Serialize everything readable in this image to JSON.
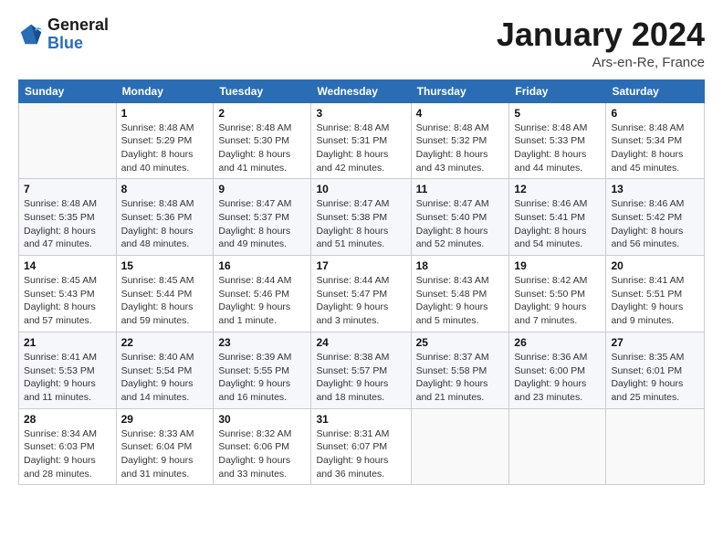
{
  "header": {
    "logo_line1": "General",
    "logo_line2": "Blue",
    "month_title": "January 2024",
    "location": "Ars-en-Re, France"
  },
  "weekdays": [
    "Sunday",
    "Monday",
    "Tuesday",
    "Wednesday",
    "Thursday",
    "Friday",
    "Saturday"
  ],
  "weeks": [
    [
      {
        "day": "",
        "info": ""
      },
      {
        "day": "1",
        "info": "Sunrise: 8:48 AM\nSunset: 5:29 PM\nDaylight: 8 hours\nand 40 minutes."
      },
      {
        "day": "2",
        "info": "Sunrise: 8:48 AM\nSunset: 5:30 PM\nDaylight: 8 hours\nand 41 minutes."
      },
      {
        "day": "3",
        "info": "Sunrise: 8:48 AM\nSunset: 5:31 PM\nDaylight: 8 hours\nand 42 minutes."
      },
      {
        "day": "4",
        "info": "Sunrise: 8:48 AM\nSunset: 5:32 PM\nDaylight: 8 hours\nand 43 minutes."
      },
      {
        "day": "5",
        "info": "Sunrise: 8:48 AM\nSunset: 5:33 PM\nDaylight: 8 hours\nand 44 minutes."
      },
      {
        "day": "6",
        "info": "Sunrise: 8:48 AM\nSunset: 5:34 PM\nDaylight: 8 hours\nand 45 minutes."
      }
    ],
    [
      {
        "day": "7",
        "info": "Sunrise: 8:48 AM\nSunset: 5:35 PM\nDaylight: 8 hours\nand 47 minutes."
      },
      {
        "day": "8",
        "info": "Sunrise: 8:48 AM\nSunset: 5:36 PM\nDaylight: 8 hours\nand 48 minutes."
      },
      {
        "day": "9",
        "info": "Sunrise: 8:47 AM\nSunset: 5:37 PM\nDaylight: 8 hours\nand 49 minutes."
      },
      {
        "day": "10",
        "info": "Sunrise: 8:47 AM\nSunset: 5:38 PM\nDaylight: 8 hours\nand 51 minutes."
      },
      {
        "day": "11",
        "info": "Sunrise: 8:47 AM\nSunset: 5:40 PM\nDaylight: 8 hours\nand 52 minutes."
      },
      {
        "day": "12",
        "info": "Sunrise: 8:46 AM\nSunset: 5:41 PM\nDaylight: 8 hours\nand 54 minutes."
      },
      {
        "day": "13",
        "info": "Sunrise: 8:46 AM\nSunset: 5:42 PM\nDaylight: 8 hours\nand 56 minutes."
      }
    ],
    [
      {
        "day": "14",
        "info": "Sunrise: 8:45 AM\nSunset: 5:43 PM\nDaylight: 8 hours\nand 57 minutes."
      },
      {
        "day": "15",
        "info": "Sunrise: 8:45 AM\nSunset: 5:44 PM\nDaylight: 8 hours\nand 59 minutes."
      },
      {
        "day": "16",
        "info": "Sunrise: 8:44 AM\nSunset: 5:46 PM\nDaylight: 9 hours\nand 1 minute."
      },
      {
        "day": "17",
        "info": "Sunrise: 8:44 AM\nSunset: 5:47 PM\nDaylight: 9 hours\nand 3 minutes."
      },
      {
        "day": "18",
        "info": "Sunrise: 8:43 AM\nSunset: 5:48 PM\nDaylight: 9 hours\nand 5 minutes."
      },
      {
        "day": "19",
        "info": "Sunrise: 8:42 AM\nSunset: 5:50 PM\nDaylight: 9 hours\nand 7 minutes."
      },
      {
        "day": "20",
        "info": "Sunrise: 8:41 AM\nSunset: 5:51 PM\nDaylight: 9 hours\nand 9 minutes."
      }
    ],
    [
      {
        "day": "21",
        "info": "Sunrise: 8:41 AM\nSunset: 5:53 PM\nDaylight: 9 hours\nand 11 minutes."
      },
      {
        "day": "22",
        "info": "Sunrise: 8:40 AM\nSunset: 5:54 PM\nDaylight: 9 hours\nand 14 minutes."
      },
      {
        "day": "23",
        "info": "Sunrise: 8:39 AM\nSunset: 5:55 PM\nDaylight: 9 hours\nand 16 minutes."
      },
      {
        "day": "24",
        "info": "Sunrise: 8:38 AM\nSunset: 5:57 PM\nDaylight: 9 hours\nand 18 minutes."
      },
      {
        "day": "25",
        "info": "Sunrise: 8:37 AM\nSunset: 5:58 PM\nDaylight: 9 hours\nand 21 minutes."
      },
      {
        "day": "26",
        "info": "Sunrise: 8:36 AM\nSunset: 6:00 PM\nDaylight: 9 hours\nand 23 minutes."
      },
      {
        "day": "27",
        "info": "Sunrise: 8:35 AM\nSunset: 6:01 PM\nDaylight: 9 hours\nand 25 minutes."
      }
    ],
    [
      {
        "day": "28",
        "info": "Sunrise: 8:34 AM\nSunset: 6:03 PM\nDaylight: 9 hours\nand 28 minutes."
      },
      {
        "day": "29",
        "info": "Sunrise: 8:33 AM\nSunset: 6:04 PM\nDaylight: 9 hours\nand 31 minutes."
      },
      {
        "day": "30",
        "info": "Sunrise: 8:32 AM\nSunset: 6:06 PM\nDaylight: 9 hours\nand 33 minutes."
      },
      {
        "day": "31",
        "info": "Sunrise: 8:31 AM\nSunset: 6:07 PM\nDaylight: 9 hours\nand 36 minutes."
      },
      {
        "day": "",
        "info": ""
      },
      {
        "day": "",
        "info": ""
      },
      {
        "day": "",
        "info": ""
      }
    ]
  ]
}
